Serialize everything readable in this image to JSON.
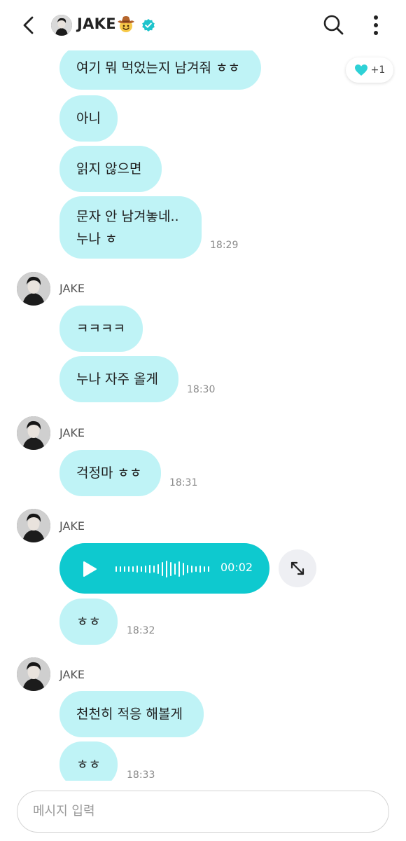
{
  "header": {
    "contact_name": "JAKE",
    "name_emoji": "cowboy-face-emoji",
    "verified_icon": "verified-badge-icon",
    "accent_color": "#0ec9cf"
  },
  "reaction": {
    "icon": "heart-icon",
    "count": "+1"
  },
  "messages": {
    "m1": {
      "text": "여기 뭐 먹었는지 남겨줘 ㅎㅎ"
    },
    "m2": {
      "text": "아니"
    },
    "m3": {
      "text": "읽지 않으면"
    },
    "m4": {
      "text": "문자 안 남겨놓네..\n누나 ㅎ",
      "time": "18:29"
    },
    "g2": {
      "sender": "JAKE",
      "m1": {
        "text": "ㅋㅋㅋㅋ"
      },
      "m2": {
        "text": "누나 자주 올게",
        "time": "18:30"
      }
    },
    "g3": {
      "sender": "JAKE",
      "m1": {
        "text": "걱정마 ㅎㅎ",
        "time": "18:31"
      }
    },
    "g4": {
      "sender": "JAKE",
      "voice": {
        "duration": "00:02",
        "play_icon": "play-icon",
        "expand_icon": "expand-icon"
      },
      "m1": {
        "text": "ㅎㅎ",
        "time": "18:32"
      }
    },
    "g5": {
      "sender": "JAKE",
      "m1": {
        "text": "천천히 적응 해볼게"
      },
      "m2": {
        "text": "ㅎㅎ",
        "time": "18:33"
      }
    }
  },
  "composer": {
    "placeholder": "메시지 입력",
    "value": ""
  },
  "colors": {
    "bubble": "#bff3f6",
    "voice_bubble": "#0ec9cf"
  }
}
